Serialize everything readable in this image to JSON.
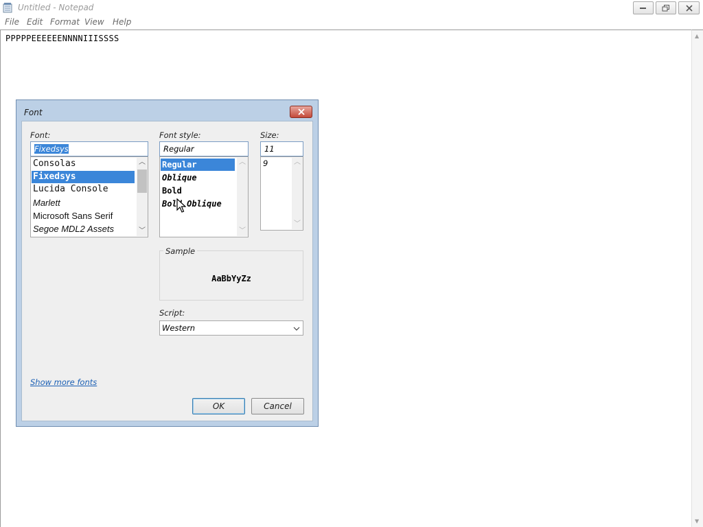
{
  "window": {
    "title": "Untitled - Notepad",
    "app_icon": "notepad-icon",
    "controls": [
      "minimize-icon",
      "maximize-icon",
      "close-icon"
    ]
  },
  "menu": {
    "file": "File",
    "edit": "Edit",
    "format": "Format",
    "view": "View",
    "help": "Help"
  },
  "editor": {
    "content": "PPPPPEEEEEENNNNIIISSSS"
  },
  "font_dialog": {
    "title": "Font",
    "font": {
      "label": "Font:",
      "value": "Fixedsys",
      "items": [
        "Consolas",
        "Fixedsys",
        "Lucida Console",
        "Marlett",
        "Microsoft Sans Serif",
        "Segoe MDL2 Assets"
      ],
      "selected": "Fixedsys"
    },
    "style": {
      "label": "Font style:",
      "value": "Regular",
      "items": [
        "Regular",
        "Oblique",
        "Bold",
        "Bold Oblique"
      ],
      "selected": "Regular"
    },
    "size": {
      "label": "Size:",
      "value": "11",
      "items": [
        "9"
      ]
    },
    "sample": {
      "label": "Sample",
      "text": "AaBbYyZz"
    },
    "script": {
      "label": "Script:",
      "value": "Western"
    },
    "show_more_fonts": "Show more fonts",
    "ok": "OK",
    "cancel": "Cancel"
  },
  "colors": {
    "selection": "#3b86d9",
    "dialog_frame": "#bcd0e6",
    "close_button": "#c44a3a",
    "link": "#1a5fb4"
  }
}
